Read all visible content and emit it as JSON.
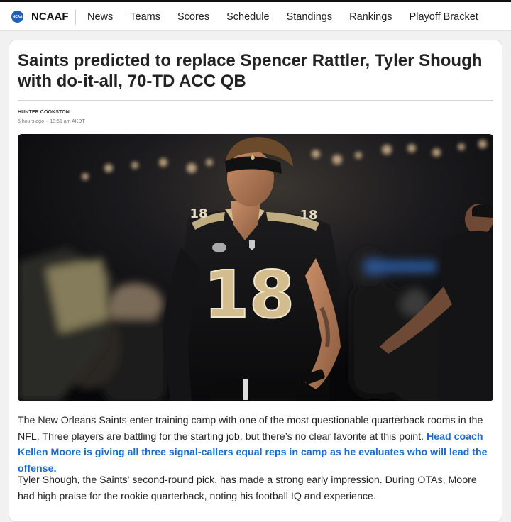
{
  "header": {
    "logo_text": "NCAA",
    "brand": "NCAAF",
    "nav_items": [
      "News",
      "Teams",
      "Scores",
      "Schedule",
      "Standings",
      "Rankings",
      "Playoff Bracket"
    ]
  },
  "article": {
    "title": "Saints predicted to replace Spencer Rattler, Tyler Shough with do-it-all, 70-TD ACC QB",
    "author": "HUNTER COOKSTON",
    "time_ago": "5 hours ago",
    "timestamp": "10:51 am AKDT",
    "image": {
      "jersey_number": "18"
    },
    "paragraph1_text": "The New Orleans Saints enter training camp with one of the most questionable quarterback rooms in the NFL. Three players are battling for the starting job, but there’s no clear favorite at this point. ",
    "paragraph1_link": "Head coach Kellen Moore is giving all three signal-callers equal reps in camp as he evaluates who will lead the offense.",
    "paragraph2_text": "Tyler Shough, the Saints' second-round pick, has made a strong early impression. During OTAs, Moore had high praise for the rookie quarterback, noting his football IQ and experience."
  },
  "colors": {
    "link": "#1a6bd0",
    "brand_badge": "#1f5fb6",
    "saints_gold": "#d3bc8d"
  }
}
